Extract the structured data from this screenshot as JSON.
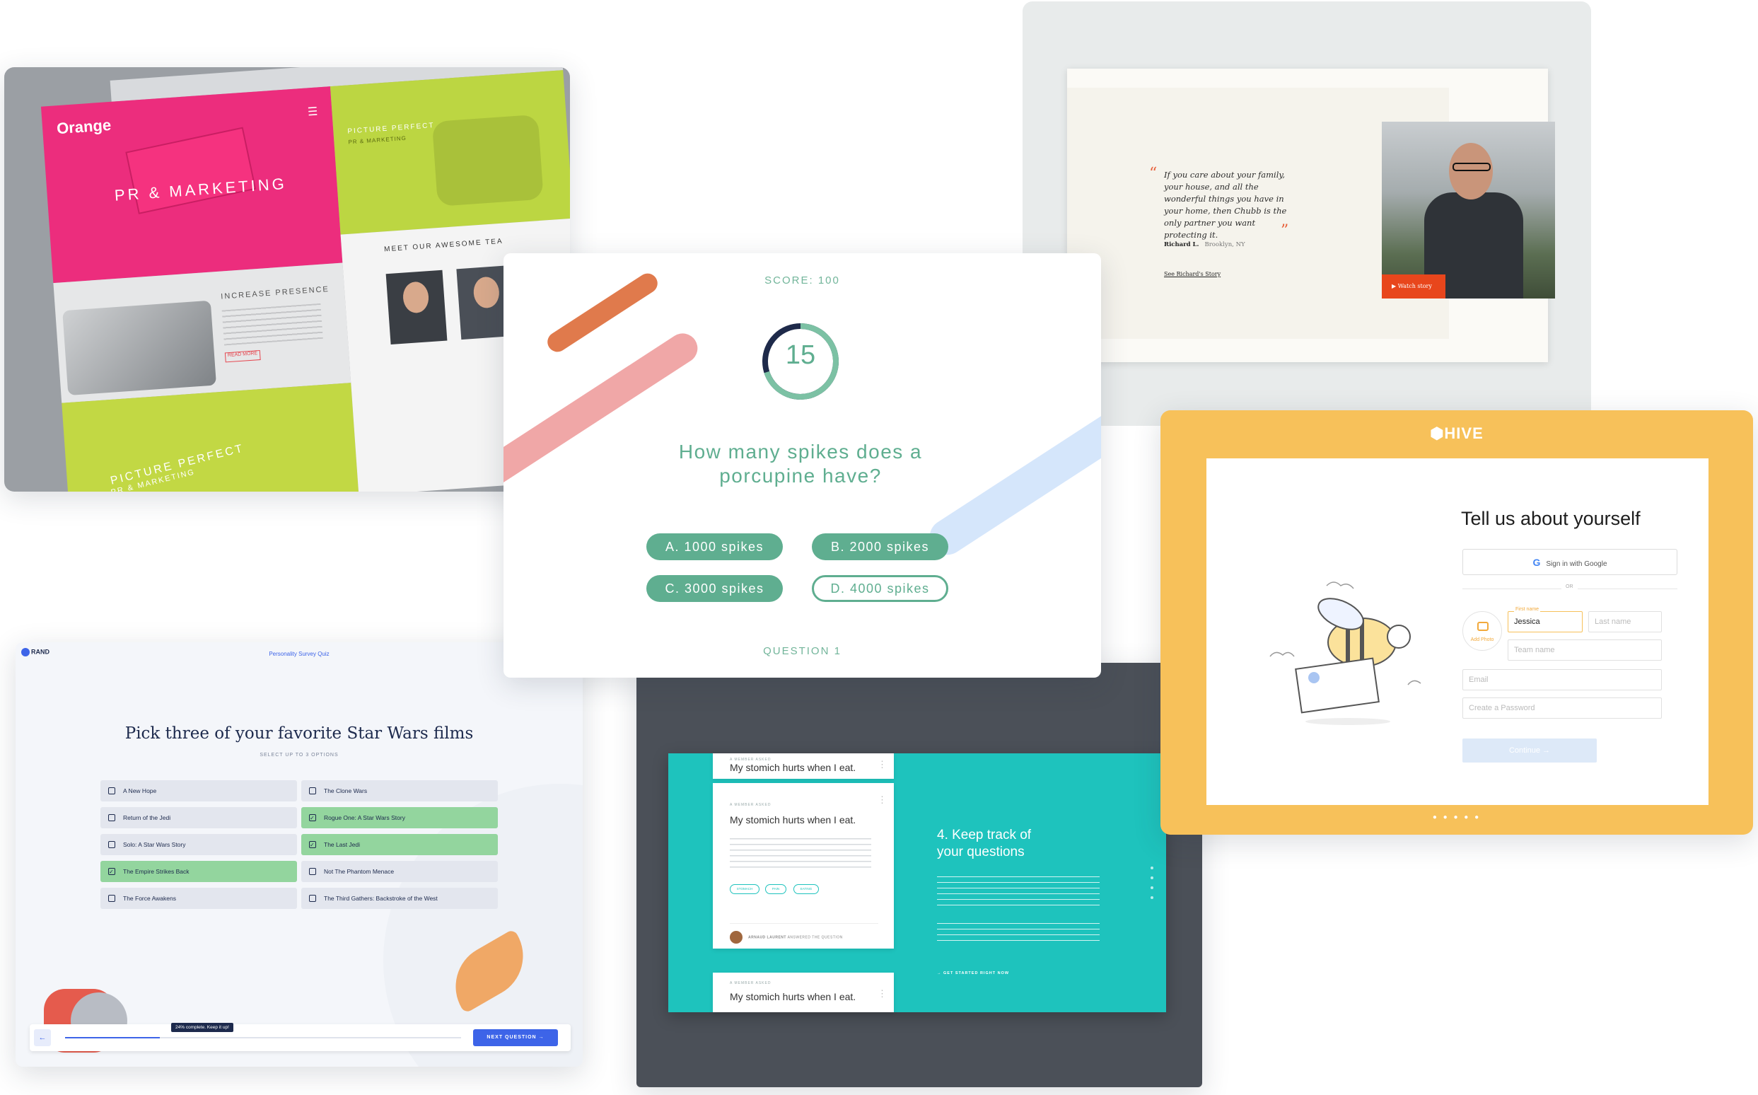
{
  "orange": {
    "logo": "Orange",
    "headline": "PR & MARKETING",
    "increase": "INCREASE PRESENCE",
    "read_more": "READ MORE",
    "picture_perfect": "PICTURE PERFECT",
    "pr_marketing": "PR & MARKETING",
    "meet_team": "MEET OUR AWESOME TEA"
  },
  "chubb": {
    "quote": "If you care about your family, your house, and all the wonderful things you have in your home, then Chubb is the only partner you want protecting it.",
    "name": "Richard L.",
    "location": "Brooklyn, NY",
    "link": "See Richard's Story",
    "watch": "Watch story"
  },
  "quiz": {
    "score": "SCORE: 100",
    "timer": "15",
    "question": "How many spikes does a porcupine have?",
    "answers": [
      "A. 1000 spikes",
      "B. 2000 spikes",
      "C. 3000 spikes",
      "D. 4000 spikes"
    ],
    "question_number": "QUESTION 1",
    "timer_fraction": 0.7,
    "accent": "#5fae90"
  },
  "hive": {
    "logo": "HIVE",
    "title": "Tell us about yourself",
    "google": "Sign in with Google",
    "or": "OR",
    "add_photo": "Add Photo",
    "first_name_label": "First name",
    "first_name_value": "Jessica",
    "last_name_placeholder": "Last name",
    "team_name_placeholder": "Team name",
    "email_placeholder": "Email",
    "password_placeholder": "Create a Password",
    "continue": "Continue",
    "dots": "● ● ● ● ●",
    "accent": "#f7c15a"
  },
  "survey": {
    "logo": "RAND",
    "nav_title": "Personality Survey Quiz",
    "title": "Pick three of your favorite Star Wars films",
    "subtitle": "SELECT UP TO 3 OPTIONS",
    "options": [
      {
        "label": "A New Hope",
        "selected": false
      },
      {
        "label": "The Clone Wars",
        "selected": false
      },
      {
        "label": "Return of the Jedi",
        "selected": false
      },
      {
        "label": "Rogue One: A Star Wars Story",
        "selected": true
      },
      {
        "label": "Solo: A Star Wars Story",
        "selected": false
      },
      {
        "label": "The Last Jedi",
        "selected": true
      },
      {
        "label": "The Empire Strikes Back",
        "selected": true
      },
      {
        "label": "Not The Phantom Menace",
        "selected": false
      },
      {
        "label": "The Force Awakens",
        "selected": false
      },
      {
        "label": "The Third Gathers: Backstroke of the West",
        "selected": false
      }
    ],
    "progress_tip": "24% complete. Keep it up!",
    "progress": 0.24,
    "next": "NEXT QUESTION",
    "accent": "#3d64e8"
  },
  "dark": {
    "author_tag": "A MEMBER ASKED",
    "question": "My stomich hurts when I eat.",
    "tags": [
      "STOMACH",
      "PAIN",
      "EATING"
    ],
    "author": "ARNAUD LAURENT",
    "answered": "ANSWERED THE QUESTION",
    "headline_line1": "4. Keep track of",
    "headline_line2": "your questions",
    "cta": "GET STARTED RIGHT NOW",
    "accent": "#1ec3bd"
  }
}
